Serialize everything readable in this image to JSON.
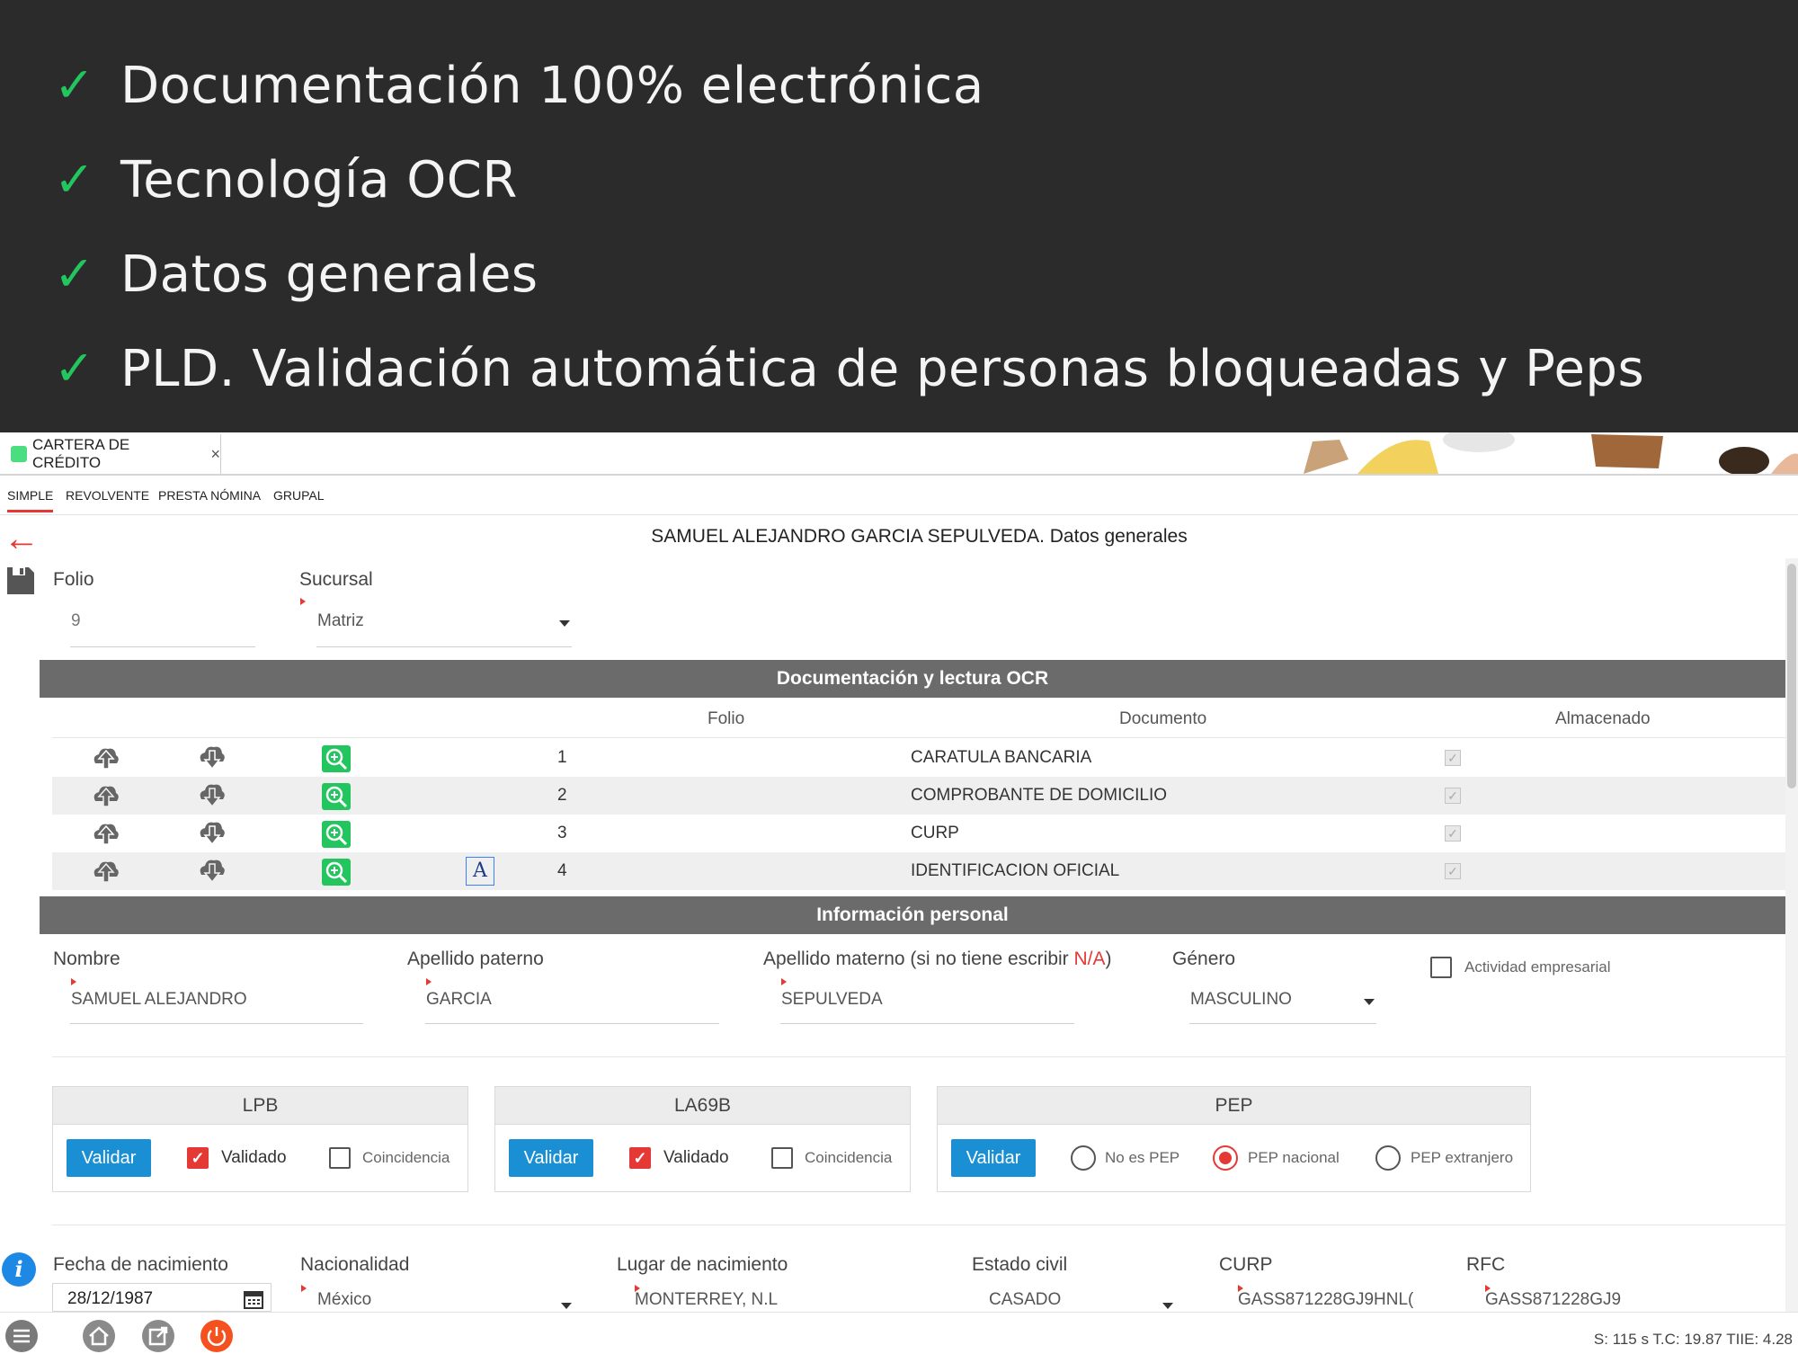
{
  "banner": {
    "bullets": [
      "Documentación 100% electrónica",
      "Tecnología OCR",
      "Datos generales",
      "PLD. Validación automática de personas bloqueadas y Peps"
    ]
  },
  "app": {
    "tab_title": "CARTERA DE CRÉDITO",
    "tab_close": "×",
    "subtabs": [
      "SIMPLE",
      "REVOLVENTE",
      "PRESTA NÓMINA",
      "GRUPAL"
    ],
    "page_title": "SAMUEL ALEJANDRO GARCIA SEPULVEDA. Datos generales",
    "folio_label": "Folio",
    "folio_value": "9",
    "sucursal_label": "Sucursal",
    "sucursal_value": "Matriz",
    "doc_section_title": "Documentación y lectura OCR",
    "doc_columns": {
      "folio": "Folio",
      "documento": "Documento",
      "almacenado": "Almacenado"
    },
    "documents": [
      {
        "folio": "1",
        "documento": "CARATULA BANCARIA",
        "almacenado": "✓"
      },
      {
        "folio": "2",
        "documento": "COMPROBANTE DE DOMICILIO",
        "almacenado": "✓"
      },
      {
        "folio": "3",
        "documento": "CURP",
        "almacenado": "✓"
      },
      {
        "folio": "4",
        "documento": "IDENTIFICACION OFICIAL",
        "almacenado": "✓"
      }
    ],
    "ocr_glyph": "A",
    "personal_section_title": "Información personal",
    "nombre_label": "Nombre",
    "nombre_value": "SAMUEL ALEJANDRO",
    "paterno_label": "Apellido paterno",
    "paterno_value": "GARCIA",
    "materno_label_pre": "Apellido materno (si no tiene escribir ",
    "materno_label_na": "N/A",
    "materno_label_post": ")",
    "materno_value": "SEPULVEDA",
    "genero_label": "Género",
    "genero_value": "MASCULINO",
    "actividad_label": "Actividad empresarial",
    "lpb": {
      "title": "LPB",
      "button": "Validar",
      "validado": "Validado",
      "coincidencia": "Coincidencia"
    },
    "la69b": {
      "title": "LA69B",
      "button": "Validar",
      "validado": "Validado",
      "coincidencia": "Coincidencia"
    },
    "pep": {
      "title": "PEP",
      "button": "Validar",
      "no_pep": "No es PEP",
      "nacional": "PEP nacional",
      "extranjero": "PEP extranjero"
    },
    "fecha_label": "Fecha de nacimiento",
    "fecha_value": "28/12/1987",
    "nacionalidad_label": "Nacionalidad",
    "nacionalidad_value": "México",
    "lugar_label": "Lugar de nacimiento",
    "lugar_value": "MONTERREY, N.L",
    "civil_label": "Estado civil",
    "civil_value": "CASADO",
    "curp_label": "CURP",
    "curp_value": "GASS871228GJ9HNL(",
    "rfc_label": "RFC",
    "rfc_value": "GASS871228GJ9",
    "status_text": "S: 115 s   T.C: 19.87   TIIE: 4.28"
  },
  "colors": {
    "accent_green": "#22c55e",
    "primary_blue": "#1a8fd4",
    "alert_red": "#e53935",
    "section_gray": "#6b6b6b",
    "banner_bg": "#2b2b2b"
  },
  "icons": [
    "check-icon",
    "back-arrow-icon",
    "save-icon",
    "upload-cloud-icon",
    "download-cloud-icon",
    "zoom-in-icon",
    "ocr-icon",
    "calendar-icon",
    "info-icon",
    "menu-icon",
    "home-icon",
    "export-icon",
    "power-icon"
  ]
}
